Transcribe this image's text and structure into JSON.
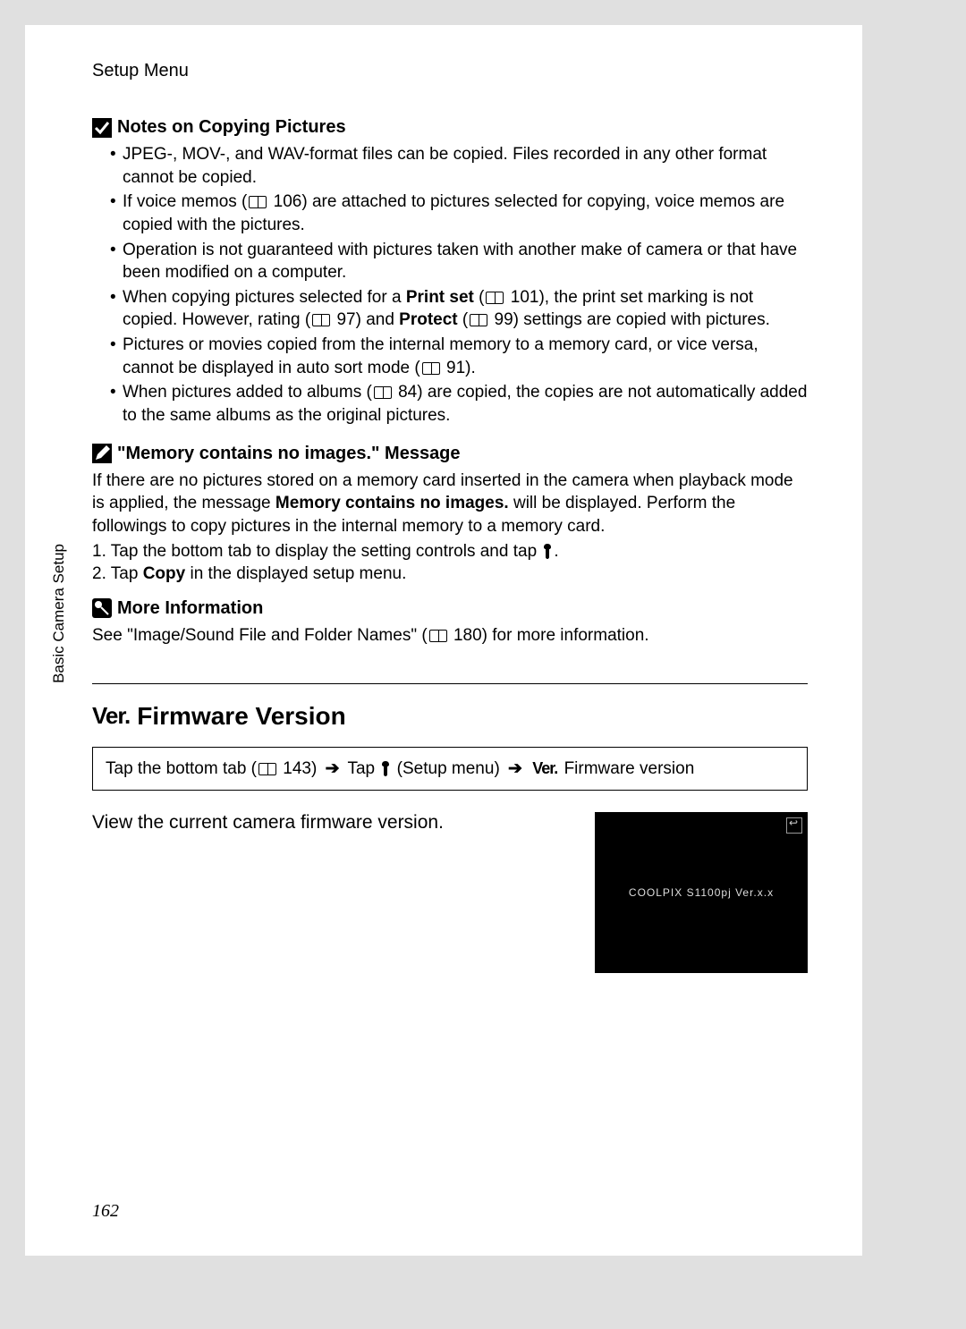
{
  "header": "Setup Menu",
  "side_label": "Basic Camera Setup",
  "page_number": "162",
  "section1": {
    "title": "Notes on Copying Pictures",
    "bullets": {
      "b1": "JPEG-, MOV-, and WAV-format files can be copied. Files recorded in any other format cannot be copied.",
      "b2a": "If voice memos (",
      "b2b": " 106) are attached to pictures selected for copying, voice memos are copied with the pictures.",
      "b3": "Operation is not guaranteed with pictures taken with another make of camera or that have been modified on a computer.",
      "b4a": "When copying pictures selected for a ",
      "b4b": "Print set",
      "b4c": " (",
      "b4d": " 101), the print set marking is not copied. However, rating (",
      "b4e": " 97) and ",
      "b4f": "Protect",
      "b4g": " (",
      "b4h": " 99) settings are copied with pictures.",
      "b5a": "Pictures or movies copied from the internal memory to a memory card, or vice versa, cannot be displayed in auto sort mode (",
      "b5b": " 91).",
      "b6a": "When pictures added to albums (",
      "b6b": " 84) are copied, the copies are not automatically added to the same albums as the original pictures."
    }
  },
  "section2": {
    "title": "\"Memory contains no images.\" Message",
    "p1a": "If there are no pictures stored on a memory card inserted in the camera when playback mode is applied, the message ",
    "p1b": "Memory contains no images.",
    "p1c": " will be displayed. Perform the followings to copy pictures in the internal memory to a memory card.",
    "ol1a": "1. Tap the bottom tab to display the setting controls and tap ",
    "ol1b": ".",
    "ol2a": "2. Tap ",
    "ol2b": "Copy",
    "ol2c": " in the displayed setup menu."
  },
  "section3": {
    "title": "More Information",
    "p1a": "See \"Image/Sound File and Folder Names\" (",
    "p1b": " 180) for more information."
  },
  "firmware": {
    "title": "Firmware Version",
    "nav_a": "Tap the bottom tab (",
    "nav_b": " 143) ",
    "nav_c": " Tap ",
    "nav_d": " (Setup menu) ",
    "nav_e": " Firmware version",
    "desc": "View the current camera firmware version.",
    "screen_text": "COOLPIX S1100pj Ver.x.x"
  }
}
